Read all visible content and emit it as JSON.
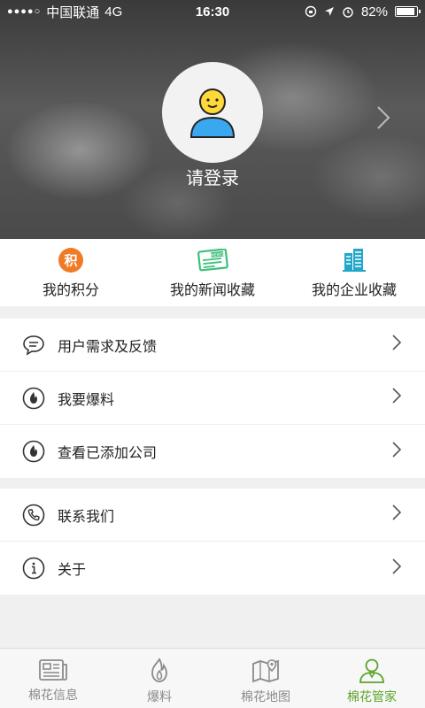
{
  "status_bar": {
    "carrier": "中国联通",
    "network": "4G",
    "time": "16:30",
    "battery": "82%"
  },
  "profile": {
    "login_label": "请登录"
  },
  "quick_actions": [
    {
      "label": "我的积分",
      "icon": "points-icon",
      "badge": "积"
    },
    {
      "label": "我的新闻收藏",
      "icon": "news-icon",
      "badge": "NEWS"
    },
    {
      "label": "我的企业收藏",
      "icon": "building-icon"
    }
  ],
  "menu_group_1": [
    {
      "label": "用户需求及反馈",
      "icon": "chat-icon"
    },
    {
      "label": "我要爆料",
      "icon": "flame-icon"
    },
    {
      "label": "查看已添加公司",
      "icon": "flame-icon"
    }
  ],
  "menu_group_2": [
    {
      "label": "联系我们",
      "icon": "phone-icon"
    },
    {
      "label": "关于",
      "icon": "info-icon"
    }
  ],
  "tabs": [
    {
      "label": "棉花信息",
      "icon": "newspaper-icon",
      "active": false
    },
    {
      "label": "爆料",
      "icon": "flame-icon",
      "active": false
    },
    {
      "label": "棉花地图",
      "icon": "map-icon",
      "active": false
    },
    {
      "label": "棉花管家",
      "icon": "user-icon",
      "active": true
    }
  ],
  "colors": {
    "accent": "#5ba428",
    "points_orange": "#f07b26",
    "news_green": "#3cc07a",
    "building_teal": "#22a7c8",
    "avatar_yellow": "#ffd83a",
    "avatar_blue": "#3aa7ee"
  }
}
